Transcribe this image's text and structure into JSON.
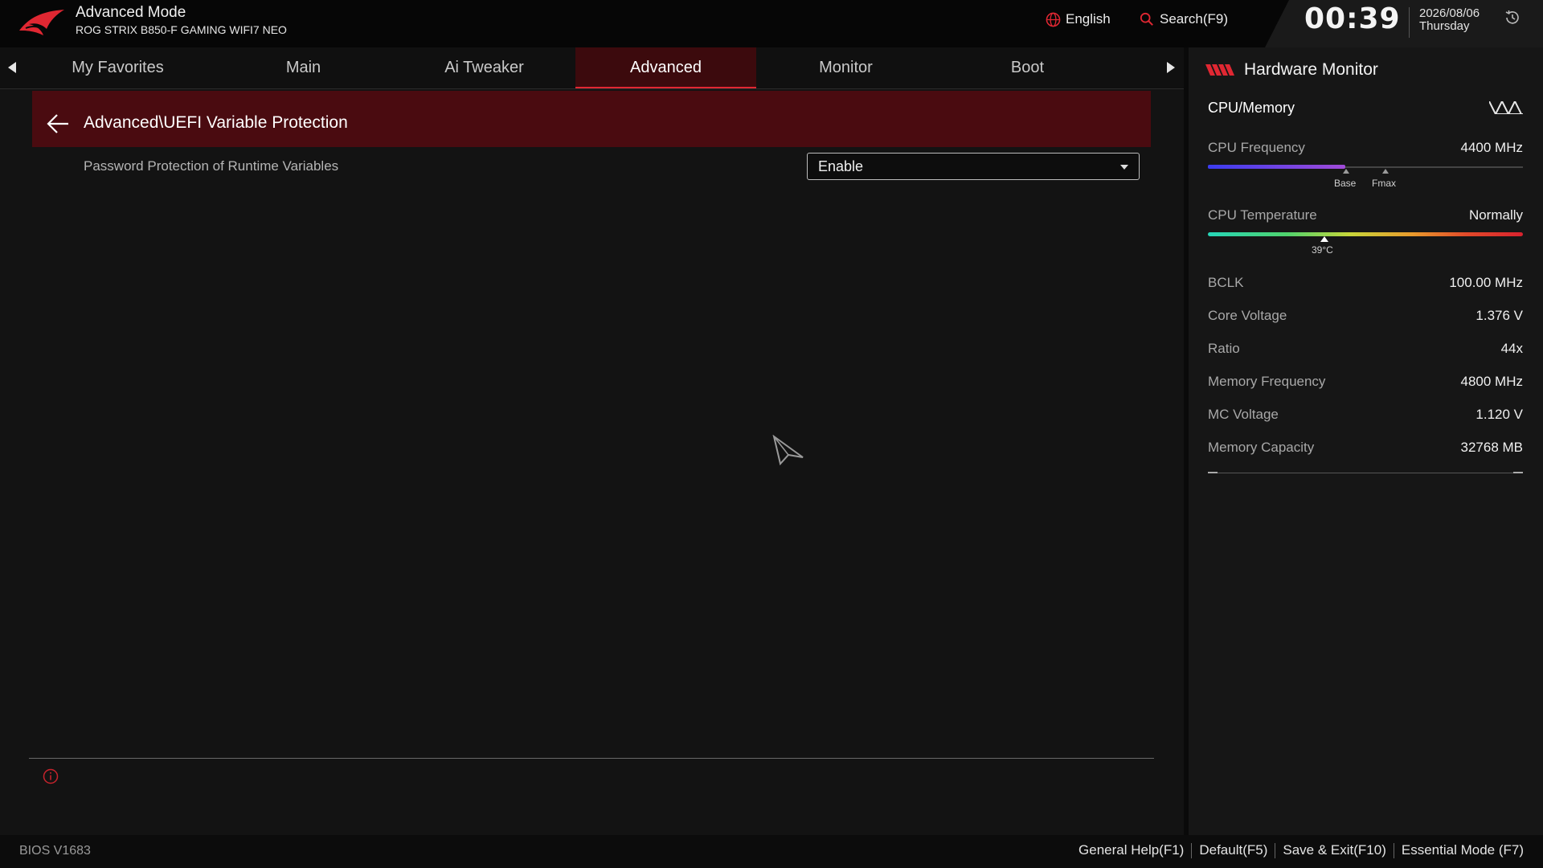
{
  "header": {
    "mode_title": "Advanced Mode",
    "board_name": "ROG STRIX B850-F GAMING WIFI7 NEO",
    "language": "English",
    "search_label": "Search(F9)",
    "time": "00:39",
    "date": "2026/08/06",
    "weekday": "Thursday"
  },
  "tabs": [
    "My Favorites",
    "Main",
    "Ai Tweaker",
    "Advanced",
    "Monitor",
    "Boot"
  ],
  "active_tab": "Advanced",
  "main": {
    "breadcrumb": "Advanced\\UEFI Variable Protection",
    "settings": [
      {
        "label": "Password Protection of Runtime Variables",
        "value": "Enable"
      }
    ]
  },
  "hardware_monitor": {
    "title": "Hardware Monitor",
    "section": "CPU/Memory",
    "cpu_frequency": {
      "label": "CPU Frequency",
      "value": "4400 MHz",
      "markers": [
        "Base",
        "Fmax"
      ]
    },
    "cpu_temperature": {
      "label": "CPU Temperature",
      "value": "Normally",
      "reading": "39°C"
    },
    "rows": [
      {
        "label": "BCLK",
        "value": "100.00 MHz"
      },
      {
        "label": "Core Voltage",
        "value": "1.376 V"
      },
      {
        "label": "Ratio",
        "value": "44x"
      },
      {
        "label": "Memory Frequency",
        "value": "4800 MHz"
      },
      {
        "label": "MC Voltage",
        "value": "1.120 V"
      },
      {
        "label": "Memory Capacity",
        "value": "32768 MB"
      }
    ]
  },
  "footer": {
    "bios_version": "BIOS V1683",
    "actions": [
      "General Help(F1)",
      "Default(F5)",
      "Save & Exit(F10)",
      "Essential Mode (F7)"
    ]
  },
  "colors": {
    "accent_red": "#e02732",
    "breadcrumb_bg": "#4a0b10",
    "background": "#131313"
  }
}
